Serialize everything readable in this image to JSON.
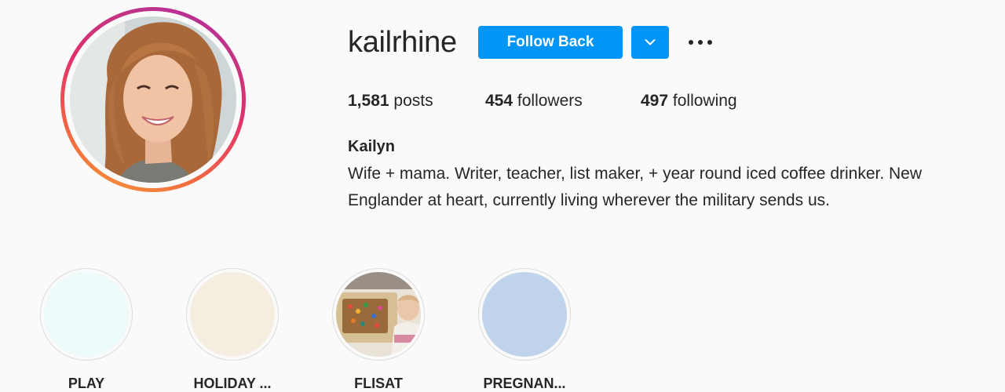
{
  "profile": {
    "username": "kailrhine",
    "follow_label": "Follow Back",
    "stats": {
      "posts_count": "1,581",
      "posts_label": "posts",
      "followers_count": "454",
      "followers_label": "followers",
      "following_count": "497",
      "following_label": "following"
    },
    "full_name": "Kailyn",
    "bio": "Wife + mama. Writer, teacher, list maker, + year round iced coffee drinker. New Englander at heart, currently living wherever the military sends us."
  },
  "icons": {
    "dropdown": "chevron-down-icon",
    "more": "more-options-icon"
  },
  "highlights": [
    {
      "label": "PLAY",
      "color": "#eefbfb"
    },
    {
      "label": "HOLIDAY ...",
      "color": "#f5eee0"
    },
    {
      "label": "FLISAT",
      "color": "#d9c8a8"
    },
    {
      "label": "PREGNAN...",
      "color": "#bfd3ea"
    }
  ],
  "colors": {
    "accent": "#0095f6",
    "story_ring_start": "#f9a03a",
    "story_ring_end": "#b02aa5",
    "text": "#262626",
    "background": "#fafafa"
  }
}
